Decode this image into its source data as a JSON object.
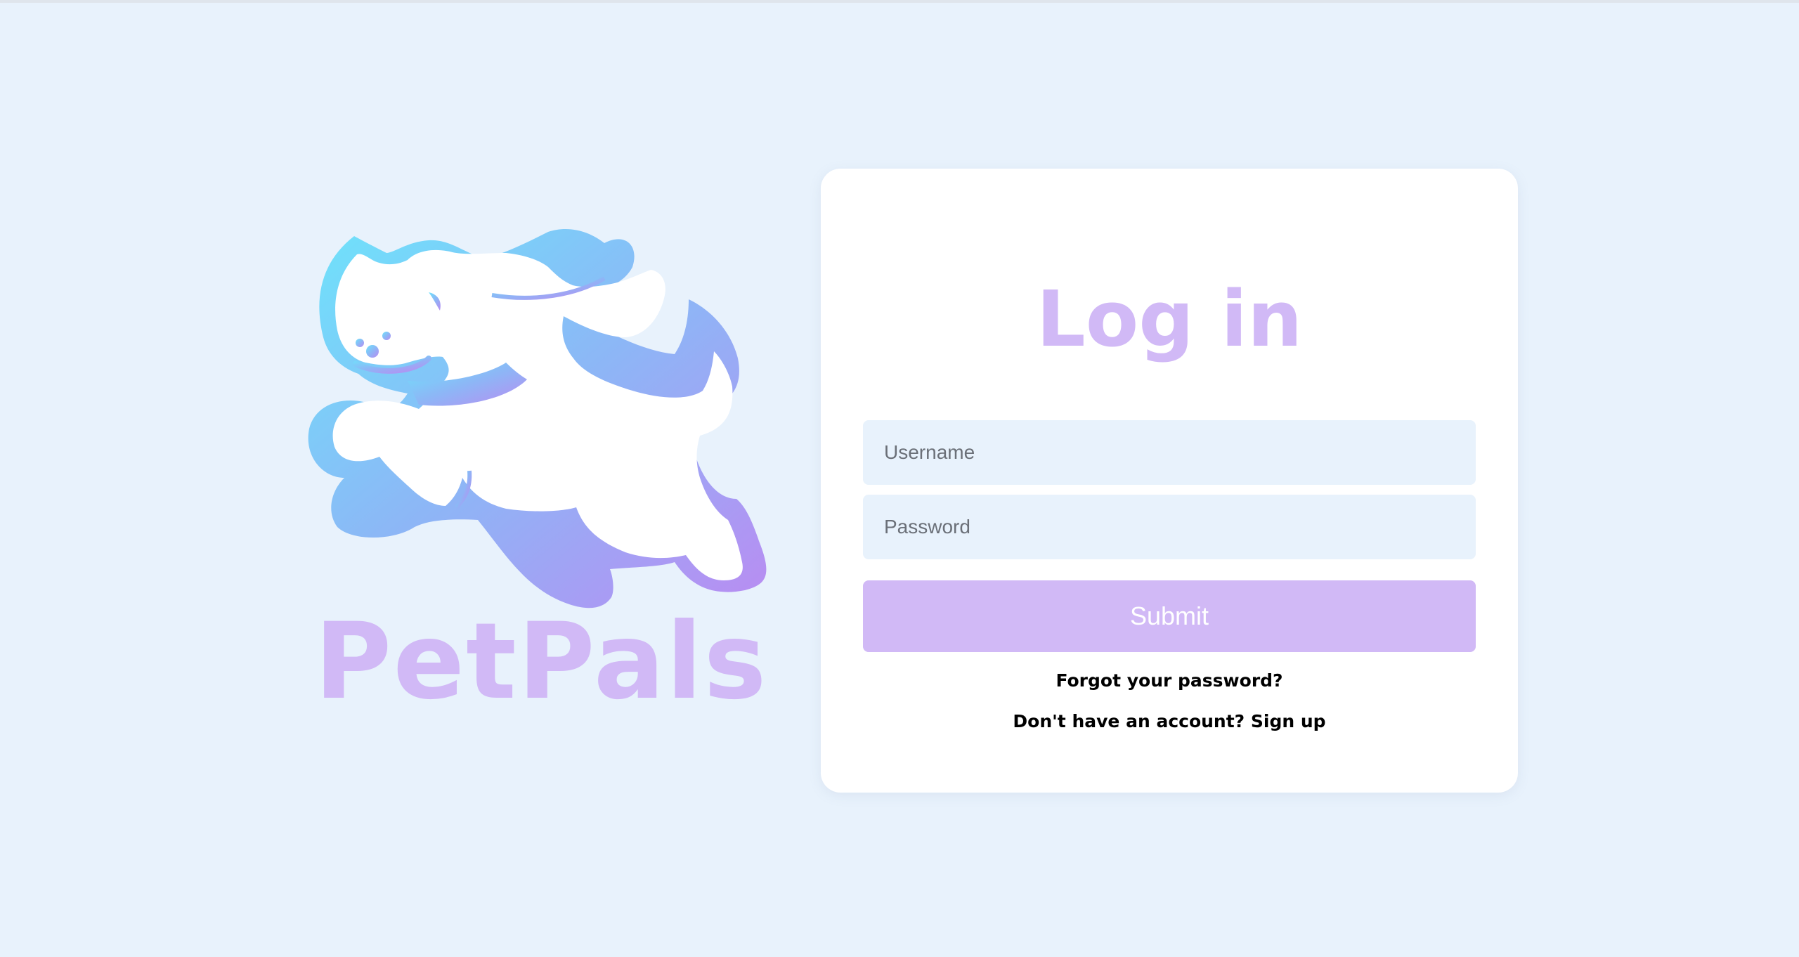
{
  "brand": {
    "name": "PetPals",
    "logo_icon": "running-dog-logo",
    "color": "#d1b9f6",
    "gradient": [
      "#6ee3fb",
      "#8db6f6",
      "#b98cf2"
    ]
  },
  "login": {
    "title": "Log in",
    "username_placeholder": "Username",
    "password_placeholder": "Password",
    "submit_label": "Submit",
    "forgot_label": "Forgot your password?",
    "signup_label": "Don't have an account? Sign up"
  },
  "colors": {
    "background": "#e8f2fc",
    "card": "#ffffff",
    "accent": "#d1b9f6",
    "input_bg": "#e8f2fc"
  }
}
